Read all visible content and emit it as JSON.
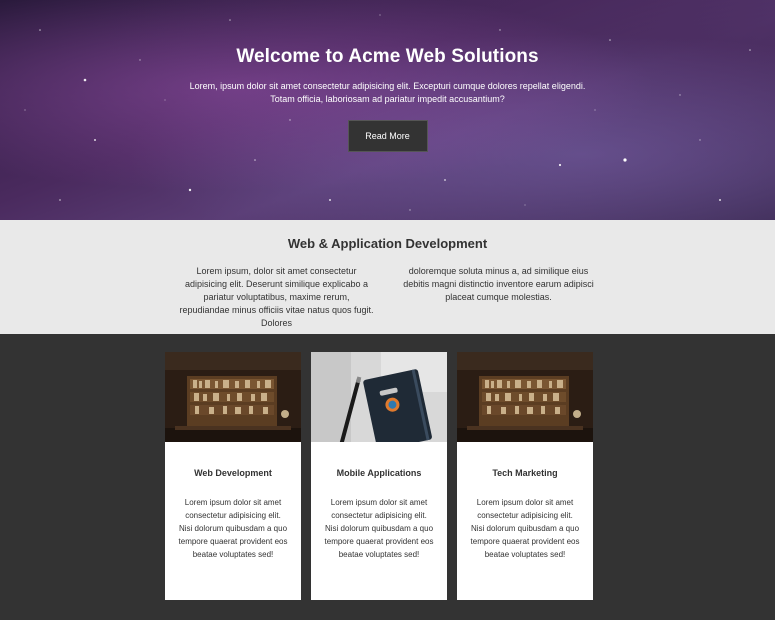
{
  "hero": {
    "title": "Welcome to Acme Web Solutions",
    "text": "Lorem, ipsum dolor sit amet consectetur adipisicing elit. Excepturi cumque dolores repellat eligendi. Totam officia, laboriosam ad pariatur impedit accusantium?",
    "button_label": "Read More"
  },
  "services": {
    "title": "Web & Application Development",
    "column_left": "Lorem ipsum, dolor sit amet consectetur adipisicing elit. Deserunt similique explicabo a pariatur voluptatibus, maxime rerum, repudiandae minus officiis vitae natus quos fugit. Dolores",
    "column_right": "doloremque soluta minus a, ad similique eius debitis magni distinctio inventore earum adipisci placeat cumque molestias."
  },
  "cards": [
    {
      "title": "Web Development",
      "text": "Lorem ipsum dolor sit amet consectetur adipisicing elit. Nisi dolorum quibusdam a quo tempore quaerat provident eos beatae voluptates sed!",
      "image": "bookshelf-photo"
    },
    {
      "title": "Mobile Applications",
      "text": "Lorem ipsum dolor sit amet consectetur adipisicing elit. Nisi dolorum quibusdam a quo tempore quaerat provident eos beatae voluptates sed!",
      "image": "notebook-pen-photo"
    },
    {
      "title": "Tech Marketing",
      "text": "Lorem ipsum dolor sit amet consectetur adipisicing elit. Nisi dolorum quibusdam a quo tempore quaerat provident eos beatae voluptates sed!",
      "image": "bookshelf-photo"
    }
  ],
  "colors": {
    "dark": "#333333",
    "light_section": "#e9e9e9",
    "card_bg": "#ffffff"
  }
}
